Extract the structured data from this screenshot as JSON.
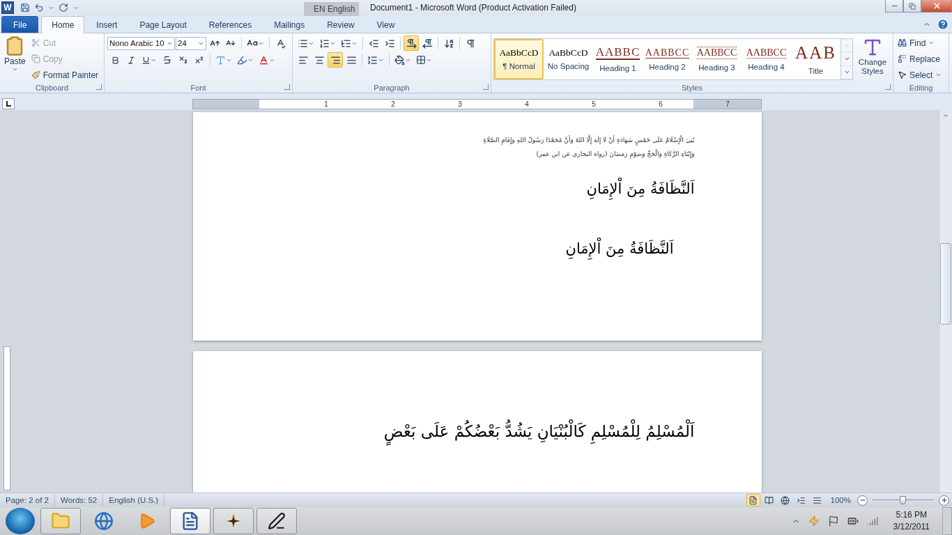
{
  "title_bar": {
    "logo": "W",
    "language_bar": "EN English",
    "title": "Document1  -  Microsoft Word (Product Activation Failed)"
  },
  "tabs": [
    {
      "label": "File",
      "kind": "file",
      "selected": false
    },
    {
      "label": "Home",
      "kind": "tab",
      "selected": true
    },
    {
      "label": "Insert",
      "kind": "tab",
      "selected": false
    },
    {
      "label": "Page Layout",
      "kind": "tab",
      "selected": false
    },
    {
      "label": "References",
      "kind": "tab",
      "selected": false
    },
    {
      "label": "Mailings",
      "kind": "tab",
      "selected": false
    },
    {
      "label": "Review",
      "kind": "tab",
      "selected": false
    },
    {
      "label": "View",
      "kind": "tab",
      "selected": false
    }
  ],
  "clipboard": {
    "group": "Clipboard",
    "paste": "Paste",
    "cut": {
      "label": "Cut",
      "disabled": true
    },
    "copy": {
      "label": "Copy",
      "disabled": true
    },
    "format_painter": "Format Painter"
  },
  "font": {
    "group": "Font",
    "name": "Nono Arabic 10",
    "size": "24"
  },
  "paragraph": {
    "group": "Paragraph",
    "toggles": [
      {
        "kind": "ltr",
        "on": true
      },
      {
        "kind": "rtl",
        "on": false
      }
    ],
    "show_marks": {
      "on": false
    },
    "alignment": [
      {
        "kind": "left",
        "selected": false
      },
      {
        "kind": "center",
        "selected": false
      },
      {
        "kind": "right",
        "selected": true
      },
      {
        "kind": "justify",
        "selected": false
      }
    ]
  },
  "styles": {
    "group": "Styles",
    "items": [
      {
        "preview": "AaBbCcD",
        "name": "¶ Normal",
        "kind": "plain",
        "selected": true
      },
      {
        "preview": "AaBbCcD",
        "name": "No Spacing",
        "kind": "plain",
        "selected": false
      },
      {
        "preview": "AABBC",
        "name": "Heading 1",
        "kind": "thick",
        "selected": false
      },
      {
        "preview": "AABBCC",
        "name": "Heading 2",
        "kind": "thin",
        "selected": false
      },
      {
        "preview": "AABBCC",
        "name": "Heading 3",
        "kind": "dotted",
        "selected": false
      },
      {
        "preview": "AABBCC",
        "name": "Heading 4",
        "kind": "dotline",
        "selected": false
      },
      {
        "preview": "AAB",
        "name": "Title",
        "kind": "title",
        "selected": false
      }
    ],
    "change_styles": "Change Styles"
  },
  "editing": {
    "group": "Editing",
    "find": "Find",
    "replace": "Replace",
    "select": "Select"
  },
  "ruler": {
    "marks": [
      "1",
      "2",
      "3",
      "4",
      "5",
      "6",
      "7"
    ]
  },
  "document": {
    "pages": [
      {
        "paragraphs": [
          {
            "kind": "small",
            "text": "بُنِيَ الْإِسْلَامُ عَلَى خَمْسٍ شَهَادَةِ أَنْ لَا إِلٰهَ إِلَّا اللهُ وَأَنَّ مُحَمَّدًا رَسُولُ اللهِ وَإِقَامِ الصَّلَاةِ"
          },
          {
            "kind": "small",
            "text": "وَإِيْتَاءِ الزَّكَاةِ وَالْحَجِّ وَصَوْمِ رَمَضَانَ (رواه البخاري عن ابن عمر)"
          },
          {
            "kind": "heading",
            "text": "اَلنَّظَافَةُ مِنَ اْلإِمَانِ"
          },
          {
            "kind": "indented",
            "text": "اَلنَّظَافَةُ مِنَ اْلإِمَانِ"
          }
        ]
      },
      {
        "paragraphs": [
          {
            "kind": "large",
            "text": "اَلْمُسْلِمُ لِلْمُسْلِمِ كَالْبُنْيَانِ يَشُدُّ بَعْضُكُمْ عَلَى بَعْضٍ"
          }
        ]
      }
    ]
  },
  "status_bar": {
    "page": "Page: 2 of 2",
    "words": "Words: 52",
    "language": "English (U.S.)",
    "views": [
      {
        "kind": "print",
        "selected": true
      },
      {
        "kind": "reading",
        "selected": false
      },
      {
        "kind": "web",
        "selected": false
      },
      {
        "kind": "outline",
        "selected": false
      },
      {
        "kind": "draft",
        "selected": false
      }
    ],
    "zoom": "100%",
    "zoom_slider": {
      "level": 0.5
    }
  },
  "taskbar": {
    "apps": [
      {
        "kind": "explorer",
        "running": true,
        "selected": false
      },
      {
        "kind": "browser",
        "running": false,
        "selected": false
      },
      {
        "kind": "media",
        "running": false,
        "selected": false
      },
      {
        "kind": "word",
        "running": true,
        "selected": true
      },
      {
        "kind": "viewer",
        "running": true,
        "selected": false
      },
      {
        "kind": "editor",
        "running": true,
        "selected": false
      }
    ],
    "time": "5:16 PM",
    "date": "3/12/2011"
  }
}
